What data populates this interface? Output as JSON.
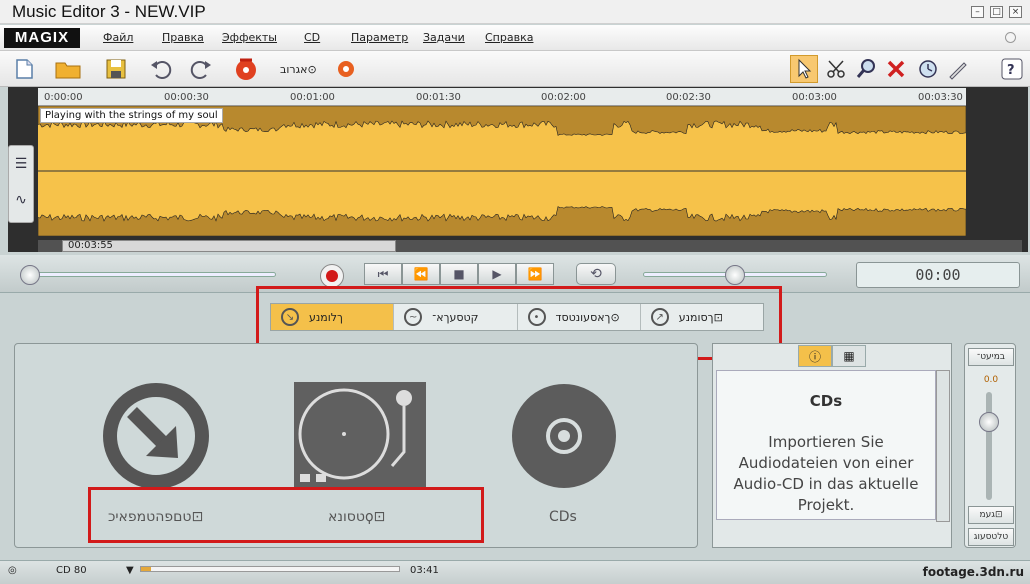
{
  "window": {
    "title": "Music Editor 3 - NEW.VIP"
  },
  "menu": {
    "logo": "MAGIX",
    "items": [
      "Файл",
      "Правка",
      "Эффекты",
      "CD",
      "Параметр",
      "Задачи",
      "Справка"
    ]
  },
  "toolbar": {
    "text_label": "אגרוב⊙"
  },
  "ruler": {
    "ticks": [
      "0:00:00",
      "00:00:30",
      "00:01:00",
      "00:01:30",
      "00:02:00",
      "00:02:30",
      "00:03:00",
      "00:03:30"
    ]
  },
  "track": {
    "label": "Playing with the strings of my soul",
    "scroll_time": "00:03:55"
  },
  "transport": {
    "time": "00:00"
  },
  "tabs": [
    {
      "label": "ךלומנע",
      "icon": "arrow-in-icon",
      "active": true
    },
    {
      "label": "קטסעךא־",
      "icon": "waveform-icon",
      "active": false
    },
    {
      "label": "ךאסעונטסד⊙",
      "icon": "disc-icon",
      "active": false
    },
    {
      "label": "ךסומנע⊡",
      "icon": "arrow-out-icon",
      "active": false
    }
  ],
  "sources": [
    {
      "label": "טםפהטמפאיכ⊡",
      "icon": "import-arrow-icon"
    },
    {
      "label": "טסונאϙ⊡",
      "icon": "turntable-icon"
    },
    {
      "label": "CDs",
      "icon": "cd-icon"
    }
  ],
  "info": {
    "title": "CDs",
    "text": "Importieren Sie Audiodateien von einer Audio-CD in das aktuelle Projekt."
  },
  "mixer": {
    "top_label": "במיעט־",
    "value": "0.0",
    "mid_label": "געמ⊡",
    "bottom_label": "טלטסעוג"
  },
  "status": {
    "cd_label": "CD 80",
    "duration": "03:41",
    "progress": 0.04
  },
  "watermark": "footage.3dn.ru",
  "colors": {
    "accent": "#f4c04a",
    "waveform": "#f6c24a",
    "highlight_box": "#d21a1a"
  }
}
